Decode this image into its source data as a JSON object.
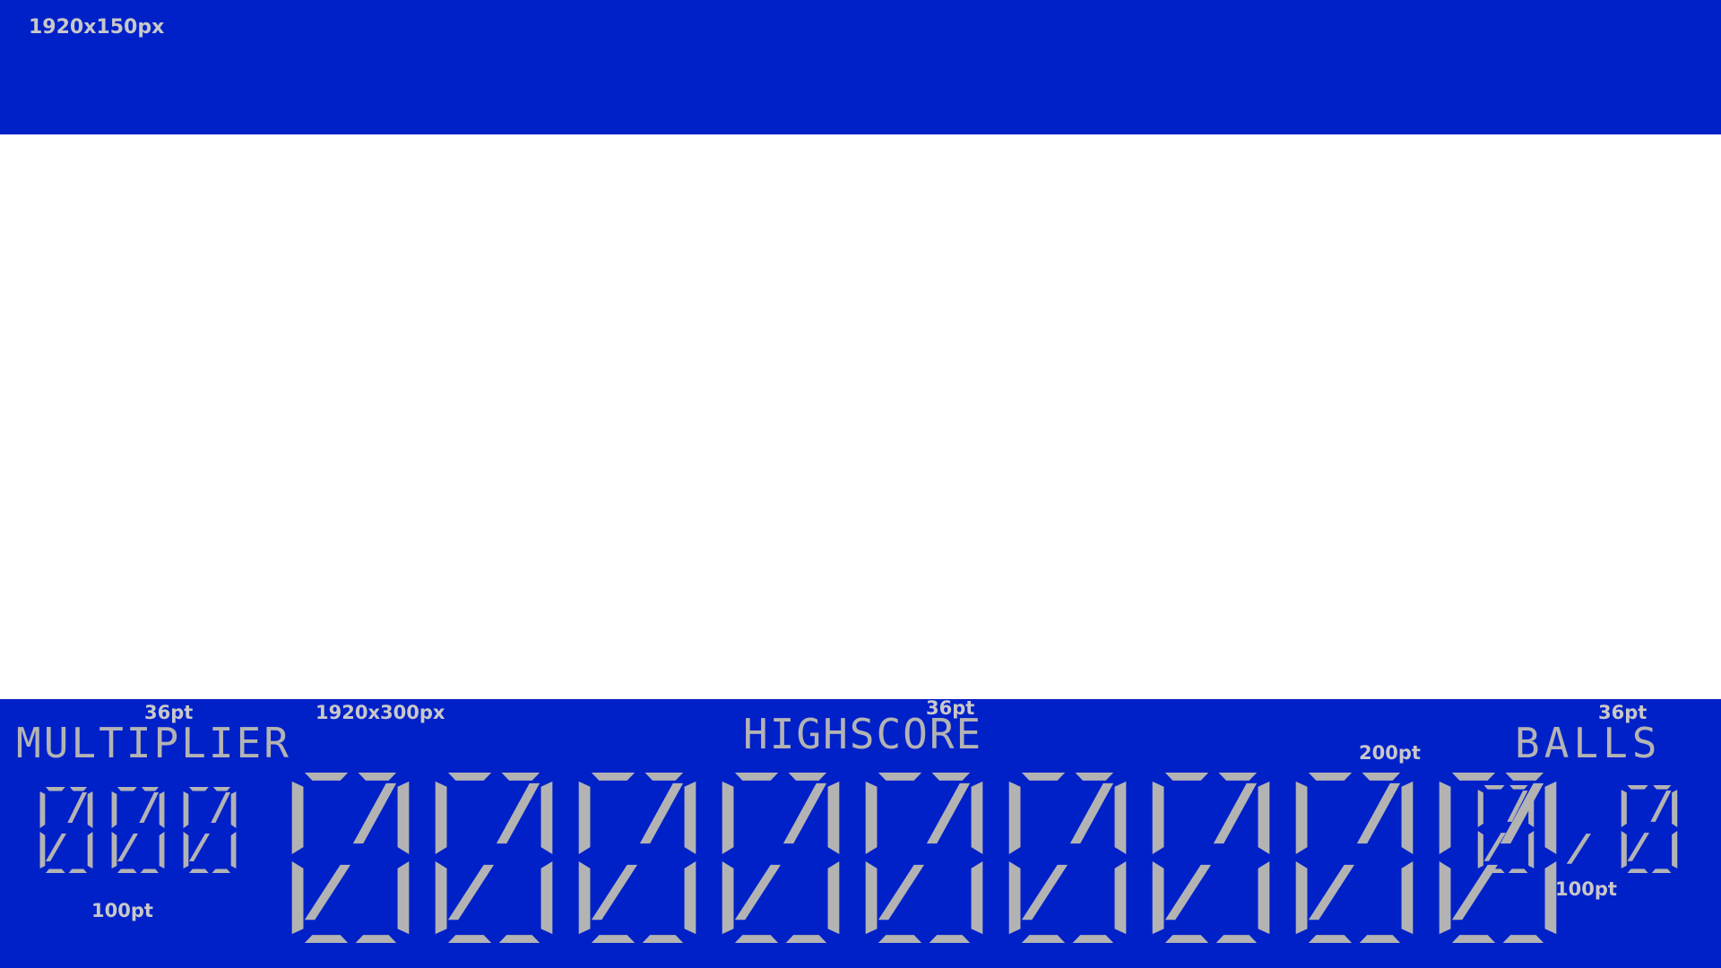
{
  "top_banner": {
    "size_note": "1920x150px"
  },
  "bottom_panel": {
    "size_note": "1920x300px",
    "multiplier": {
      "label": "MULTIPLIER",
      "label_size": "36pt",
      "value": "000",
      "value_size": "100pt"
    },
    "highscore": {
      "label": "HIGHSCORE",
      "label_size": "36pt",
      "value": "000000000",
      "value_size": "200pt"
    },
    "balls": {
      "label": "BALLS",
      "label_size": "36pt",
      "value": "0/0",
      "value_size": "100pt"
    }
  },
  "colors": {
    "panel": "#0121c8",
    "segment": "#b3b3b3",
    "note": "#c8c8c8",
    "canvas": "#ffffff"
  }
}
